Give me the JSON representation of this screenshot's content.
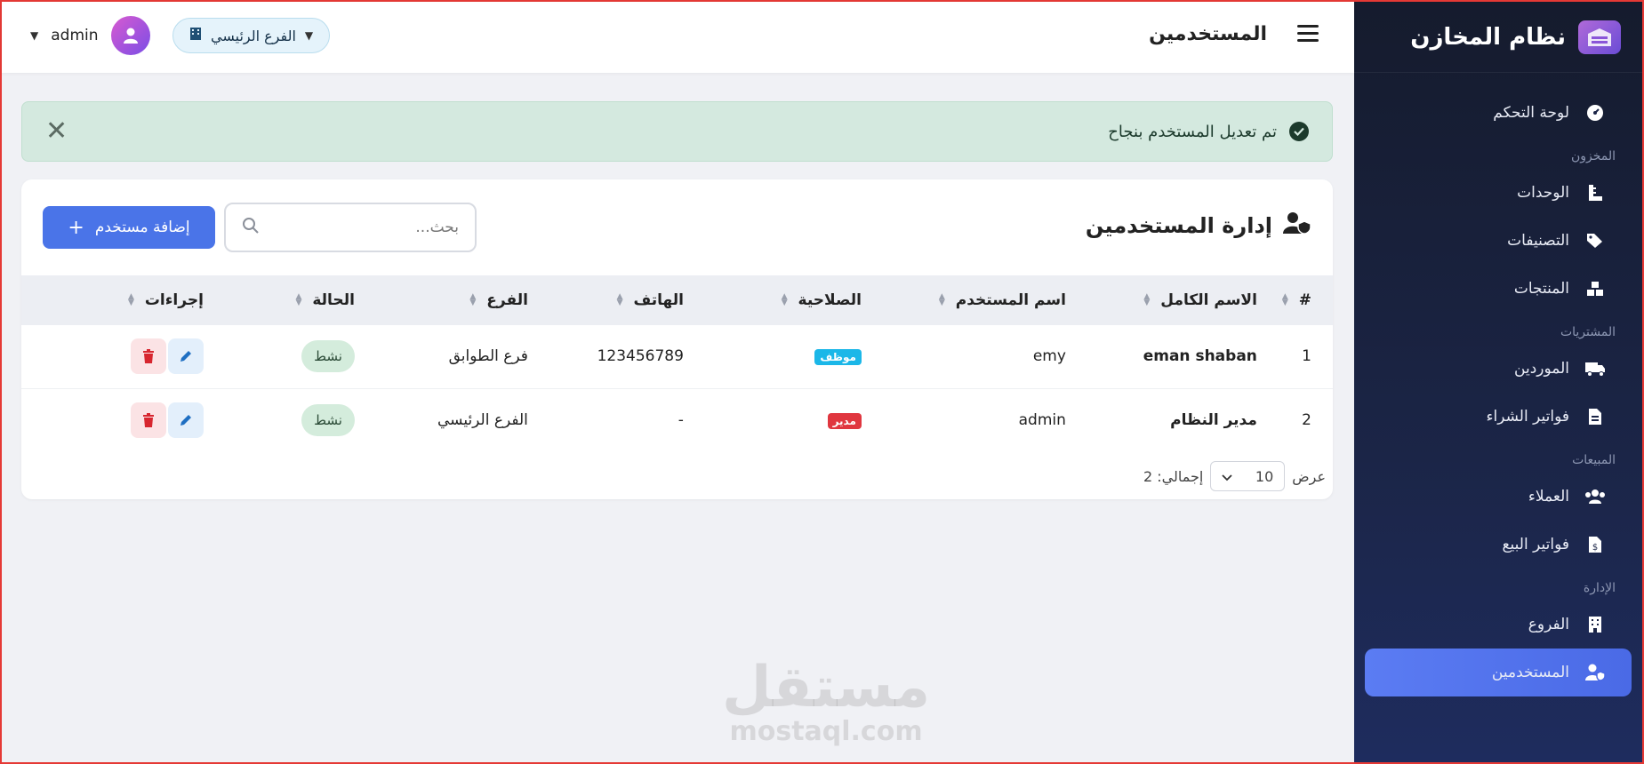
{
  "sidebar": {
    "brand": "نظام المخازن",
    "items": [
      {
        "label": "لوحة التحكم"
      },
      {
        "section": "المخزون"
      },
      {
        "label": "الوحدات"
      },
      {
        "label": "التصنيفات"
      },
      {
        "label": "المنتجات"
      },
      {
        "section": "المشتريات"
      },
      {
        "label": "الموردين"
      },
      {
        "label": "فواتير الشراء"
      },
      {
        "section": "المبيعات"
      },
      {
        "label": "العملاء"
      },
      {
        "label": "فواتير البيع"
      },
      {
        "section": "الإدارة"
      },
      {
        "label": "الفروع"
      },
      {
        "label": "المستخدمين"
      }
    ]
  },
  "topbar": {
    "title": "المستخدمين",
    "branch": "الفرع الرئيسي",
    "username": "admin"
  },
  "alert": {
    "message": "تم تعديل المستخدم بنجاح"
  },
  "card": {
    "title": "إدارة المستخدمين",
    "search_placeholder": "بحث...",
    "add_button": "إضافة مستخدم"
  },
  "table": {
    "headers": [
      "#",
      "الاسم الكامل",
      "اسم المستخدم",
      "الصلاحية",
      "الهاتف",
      "الفرع",
      "الحالة",
      "إجراءات"
    ],
    "rows": [
      {
        "num": "1",
        "full_name": "eman shaban",
        "username": "emy",
        "role": "موظف",
        "role_color": "#1bb7e8",
        "phone": "123456789",
        "branch": "فرع الطوابق",
        "status": "نشط"
      },
      {
        "num": "2",
        "full_name": "مدير النظام",
        "username": "admin",
        "role": "مدير",
        "role_color": "#e0363f",
        "phone": "-",
        "branch": "الفرع الرئيسي",
        "status": "نشط"
      }
    ]
  },
  "footer": {
    "show_label": "عرض",
    "page_size": "10",
    "total_label": "إجمالي: 2"
  },
  "watermark": {
    "arabic": "مستقل",
    "latin": "mostaql.com"
  }
}
